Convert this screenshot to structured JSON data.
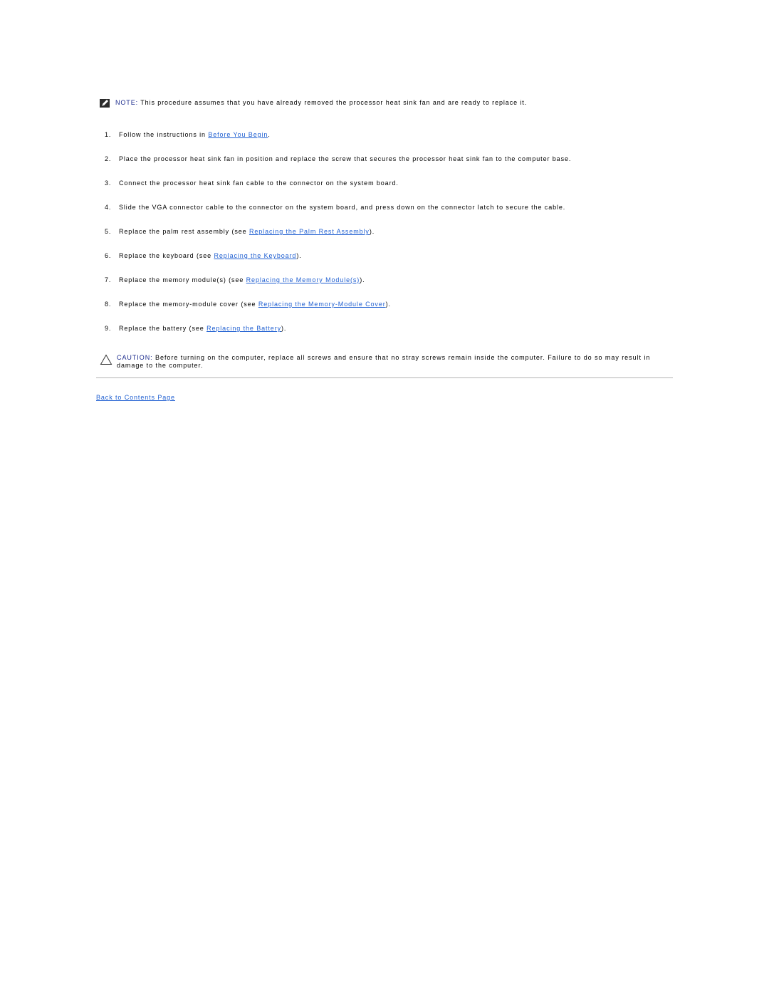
{
  "note": {
    "icon": "note-pencil-icon",
    "label": "NOTE:",
    "text": " This procedure assumes that you have already removed the processor heat sink fan and are ready to replace it."
  },
  "steps": [
    {
      "num": "1.",
      "before": "Follow the instructions in ",
      "link": "Before You Begin",
      "after": "."
    },
    {
      "num": "2.",
      "before": "Place the processor heat sink fan in position and replace the screw that secures the processor heat sink fan to the computer base.",
      "link": null,
      "after": ""
    },
    {
      "num": "3.",
      "before": "Connect the processor heat sink fan cable to the connector on the system board.",
      "link": null,
      "after": ""
    },
    {
      "num": "4.",
      "before": "Slide the VGA connector cable to the connector on the system board, and press down on the connector latch to secure the cable.",
      "link": null,
      "after": ""
    },
    {
      "num": "5.",
      "before": "Replace the palm rest assembly (see ",
      "link": "Replacing the Palm Rest Assembly",
      "after": ")."
    },
    {
      "num": "6.",
      "before": "Replace the keyboard (see ",
      "link": "Replacing the Keyboard",
      "after": ")."
    },
    {
      "num": "7.",
      "before": "Replace the memory module(s) (see ",
      "link": "Replacing the Memory Module(s)",
      "after": ")."
    },
    {
      "num": "8.",
      "before": "Replace the memory-module cover (see ",
      "link": "Replacing the Memory-Module Cover",
      "after": ")."
    },
    {
      "num": "9.",
      "before": "Replace the battery (see ",
      "link": "Replacing the Battery",
      "after": ")."
    }
  ],
  "caution": {
    "icon": "caution-triangle-icon",
    "label": "CAUTION:",
    "text": " Before turning on the computer, replace all screws and ensure that no stray screws remain inside the computer. Failure to do so may result in damage to the computer."
  },
  "footer": {
    "back_link": "Back to Contents Page"
  },
  "colors": {
    "link": "#1f5fd1",
    "label": "#1a2a8c",
    "rule": "#b4b4b4"
  }
}
